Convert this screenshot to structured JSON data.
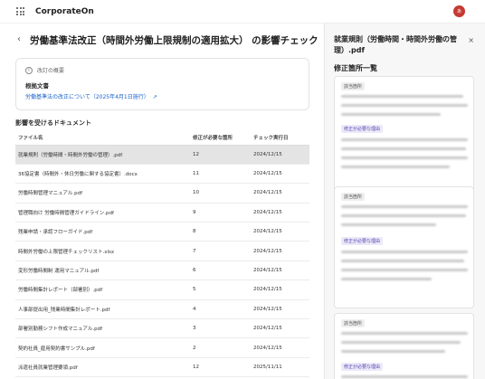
{
  "app": {
    "brand": "CorporateOn",
    "avatar_text": "あ"
  },
  "header": {
    "back_icon": "chevron-left-icon",
    "back_glyph": "‹",
    "title": "労働基準法改正（時間外労働上限規制の適用拡大） の影響チェック"
  },
  "summary": {
    "label": "改訂の概要",
    "basis_label": "根拠文書",
    "basis_link": "労働基準法の改正について（2025年4月1日施行）"
  },
  "documents": {
    "label": "影響を受けるドキュメント",
    "columns": [
      "ファイル名",
      "修正が必要な箇所",
      "チェック実行日"
    ],
    "rows": [
      [
        "就業規則（労働時間・時間外労働の管理）.pdf",
        "12",
        "2024/12/15"
      ],
      [
        "36協定書（時間外・休日労働に関する協定書）.docx",
        "11",
        "2024/12/15"
      ],
      [
        "労働時間管理マニュアル.pdf",
        "10",
        "2024/12/15"
      ],
      [
        "管理職向け 労働時間管理ガイドライン.pdf",
        "9",
        "2024/12/15"
      ],
      [
        "残業申請・承認フローガイド.pdf",
        "8",
        "2024/12/15"
      ],
      [
        "時間外労働の上限管理チェックリスト.xlsx",
        "7",
        "2024/12/15"
      ],
      [
        "変形労働時間制 運用マニュアル.pdf",
        "6",
        "2024/12/15"
      ],
      [
        "労働時間集計レポート（部署別）.pdf",
        "5",
        "2024/12/15"
      ],
      [
        "人事部提出用_残業時間集計レポート.pdf",
        "4",
        "2024/12/15"
      ],
      [
        "部署別勤務シフト作成マニュアル.pdf",
        "3",
        "2024/12/15"
      ],
      [
        "契約社員_雇用契約書サンプル.pdf",
        "2",
        "2024/12/15"
      ],
      [
        "派遣社員就業管理要領.pdf",
        "12",
        "2025/11/11"
      ]
    ]
  },
  "panel": {
    "title": "就業規則（労働時間・時間外労働の管理）.pdf",
    "close_glyph": "×",
    "subtitle": "修正箇所一覧",
    "tag_relevant": "該当箇所",
    "tag_reason": "修正が必要な理由"
  }
}
